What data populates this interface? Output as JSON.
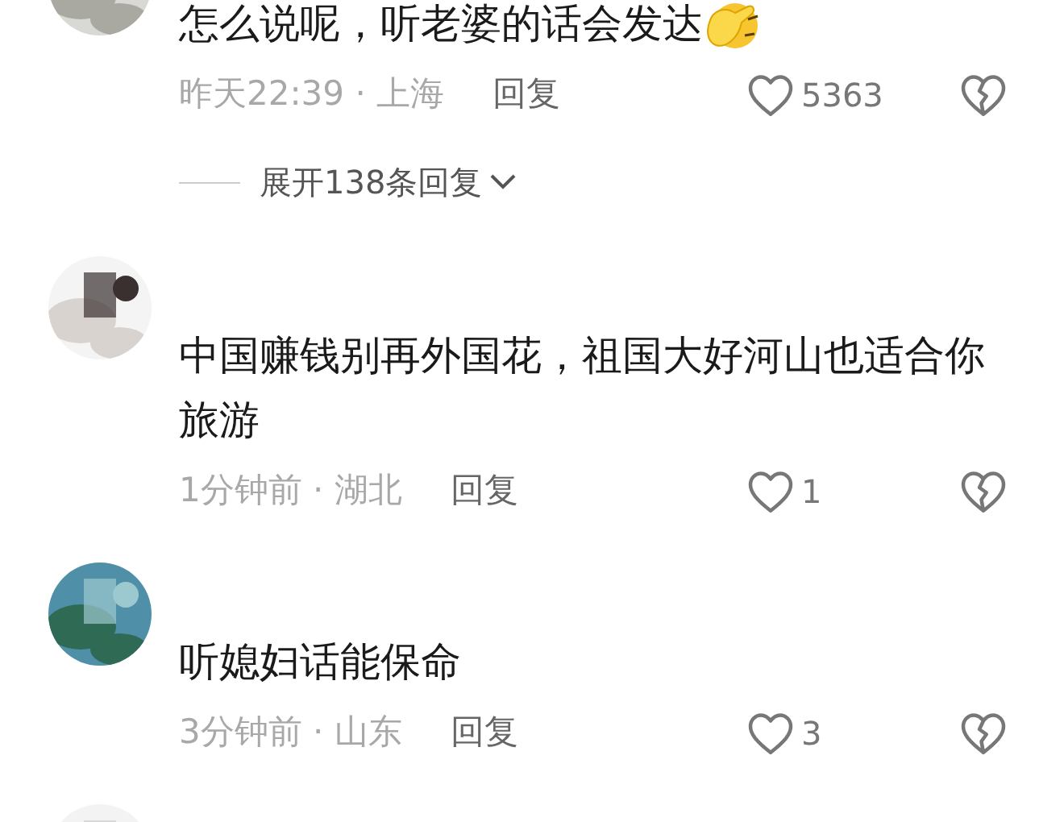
{
  "comments": [
    {
      "text": "怎么说呢，听老婆的话会发达",
      "emoji": true,
      "meta": "昨天22:39 · 上海",
      "reply": "回复",
      "likes": "5363",
      "liked": false,
      "expand": "展开138条回复"
    },
    {
      "text": "中国赚钱别再外国花，祖国大好河山也适合你旅游",
      "emoji": false,
      "meta": "1分钟前 · 湖北",
      "reply": "回复",
      "likes": "1",
      "liked": false
    },
    {
      "text": "听媳妇话能保命",
      "emoji": false,
      "meta": "3分钟前 · 山东",
      "reply": "回复",
      "likes": "3",
      "liked": false
    }
  ]
}
